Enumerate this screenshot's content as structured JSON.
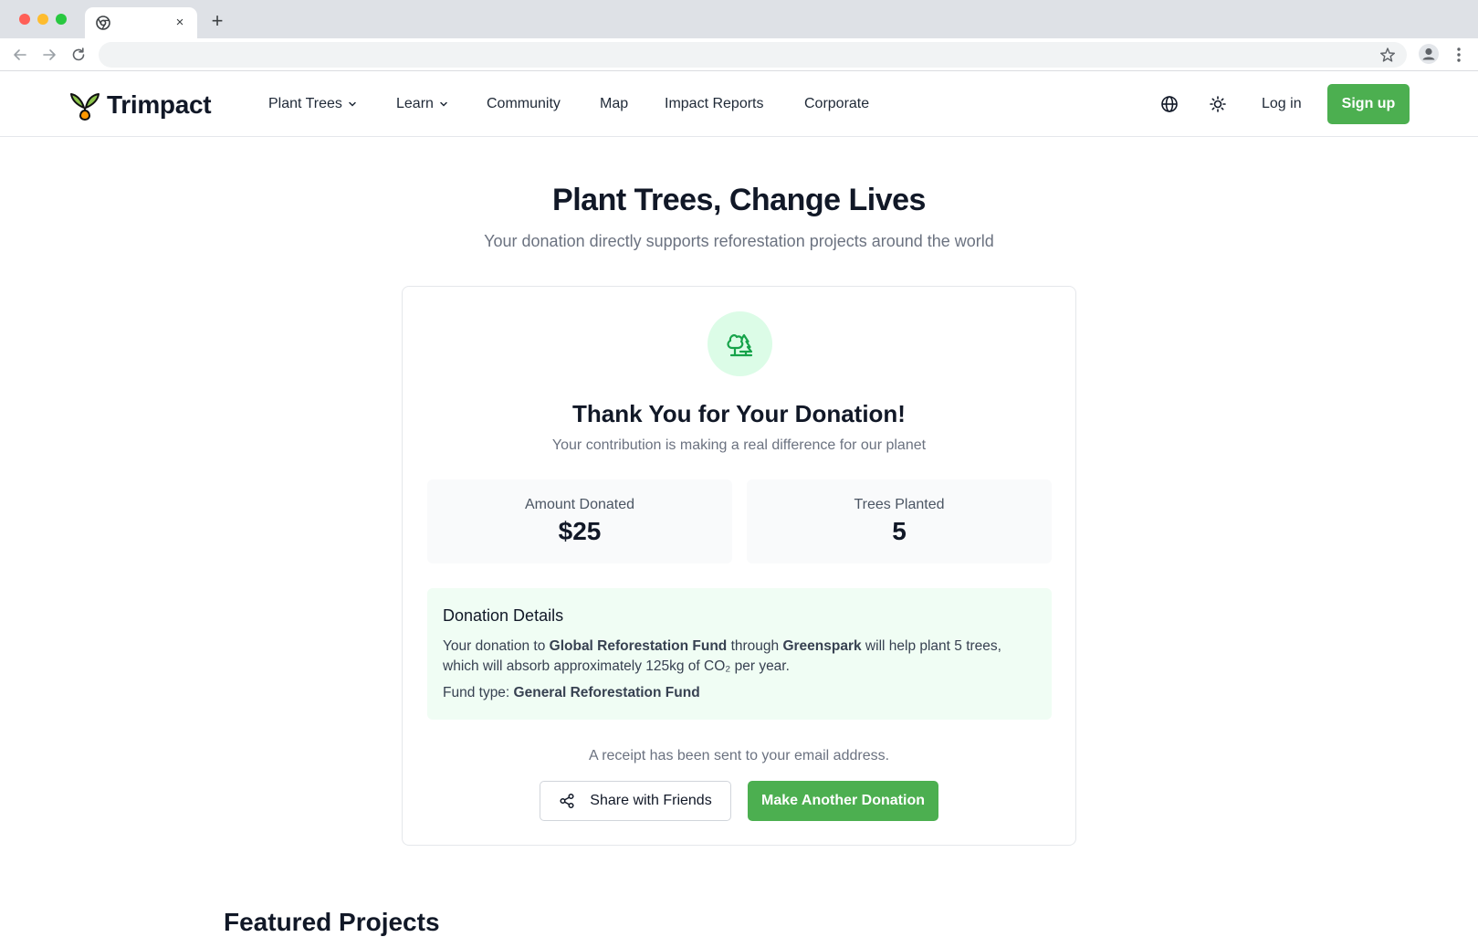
{
  "browser": {
    "tab_close": "×",
    "new_tab": "+"
  },
  "site": {
    "brand": "Trimpact",
    "nav": {
      "plant_trees": "Plant Trees",
      "learn": "Learn",
      "community": "Community",
      "map": "Map",
      "impact_reports": "Impact Reports",
      "corporate": "Corporate"
    },
    "login": "Log in",
    "signup": "Sign up"
  },
  "hero": {
    "title": "Plant Trees, Change Lives",
    "subtitle": "Your donation directly supports reforestation projects around the world"
  },
  "card": {
    "title": "Thank You for Your Donation!",
    "subtitle": "Your contribution is making a real difference for our planet",
    "amount_label": "Amount Donated",
    "amount_value": "$25",
    "trees_label": "Trees Planted",
    "trees_value": "5",
    "details": {
      "title": "Donation Details",
      "text_1": "Your donation to ",
      "fund_name": "Global Reforestation Fund",
      "text_2": " through ",
      "partner": "Greenspark",
      "text_3": " will help plant 5 trees, which will absorb approximately 125kg of CO₂ per year.",
      "fund_type_label": "Fund type: ",
      "fund_type_value": "General Reforestation Fund"
    },
    "receipt": "A receipt has been sent to your email address.",
    "share_label": "Share with Friends",
    "another_label": "Make Another Donation"
  },
  "featured_heading": "Featured Projects",
  "colors": {
    "brand_green": "#4caf50",
    "icon_green": "#16a34a",
    "badge_bg": "#dcfce7",
    "details_bg": "#f0fdf4"
  }
}
